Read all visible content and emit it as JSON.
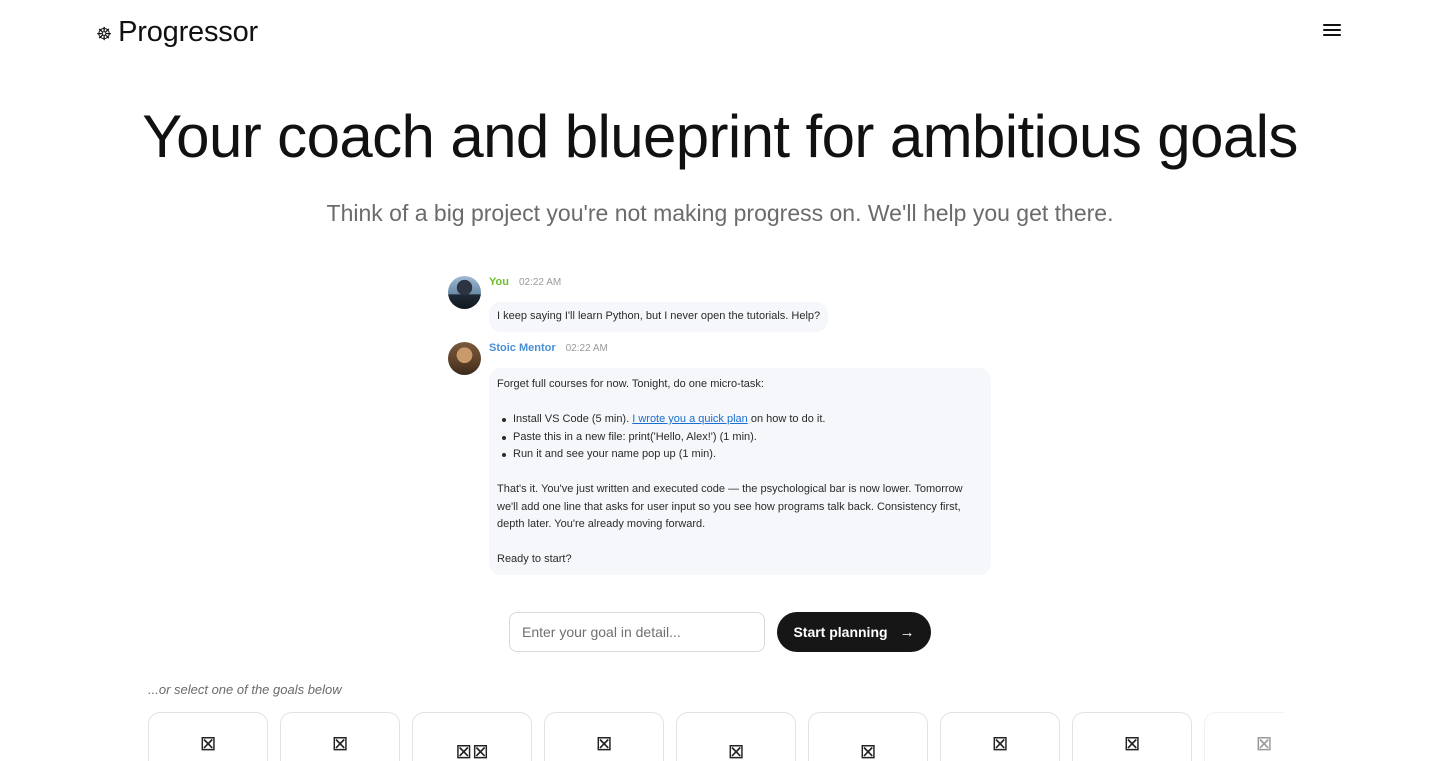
{
  "header": {
    "brand_icon": "☸",
    "brand_name": "Progressor",
    "menu_icon": "hamburger-menu-icon"
  },
  "hero": {
    "title": "Your coach and blueprint for ambitious goals",
    "subtitle": "Think of a big project you're not making progress on. We'll help you get there."
  },
  "chat": {
    "user_message": {
      "name": "You",
      "time": "02:22 AM",
      "text": "I keep saying I'll learn Python, but I never open the tutorials. Help?"
    },
    "mentor_message": {
      "name": "Stoic Mentor",
      "time": "02:22 AM",
      "intro": "Forget full courses for now. Tonight, do one micro-task:",
      "bullet1_before": "Install VS Code (5 min). ",
      "bullet1_link": "I wrote you a quick plan",
      "bullet1_after": " on how to do it.",
      "bullet2": "Paste this in a new file: print('Hello, Alex!') (1 min).",
      "bullet3": "Run it and see your name pop up (1 min).",
      "paragraph": "That's it. You've just written and executed code — the psychological bar is now lower. Tomorrow we'll add one line that asks for user input so you see how programs talk back. Consistency first, depth later. You're already moving forward.",
      "closing": "Ready to start?"
    }
  },
  "goal_form": {
    "placeholder": "Enter your goal in detail...",
    "value": "",
    "button_label": "Start planning",
    "button_icon": "arrow-right-icon"
  },
  "goal_picker": {
    "label": "...or select one of the goals below",
    "cards": [
      {
        "image_placeholder": "⊠"
      },
      {
        "image_placeholder": "⊠"
      },
      {
        "image_placeholder": "⊠⊠"
      },
      {
        "image_placeholder": "⊠"
      },
      {
        "image_placeholder": "⊠"
      },
      {
        "image_placeholder": "⊠"
      },
      {
        "image_placeholder": "⊠"
      },
      {
        "image_placeholder": "⊠"
      },
      {
        "image_placeholder": "⊠"
      }
    ]
  }
}
